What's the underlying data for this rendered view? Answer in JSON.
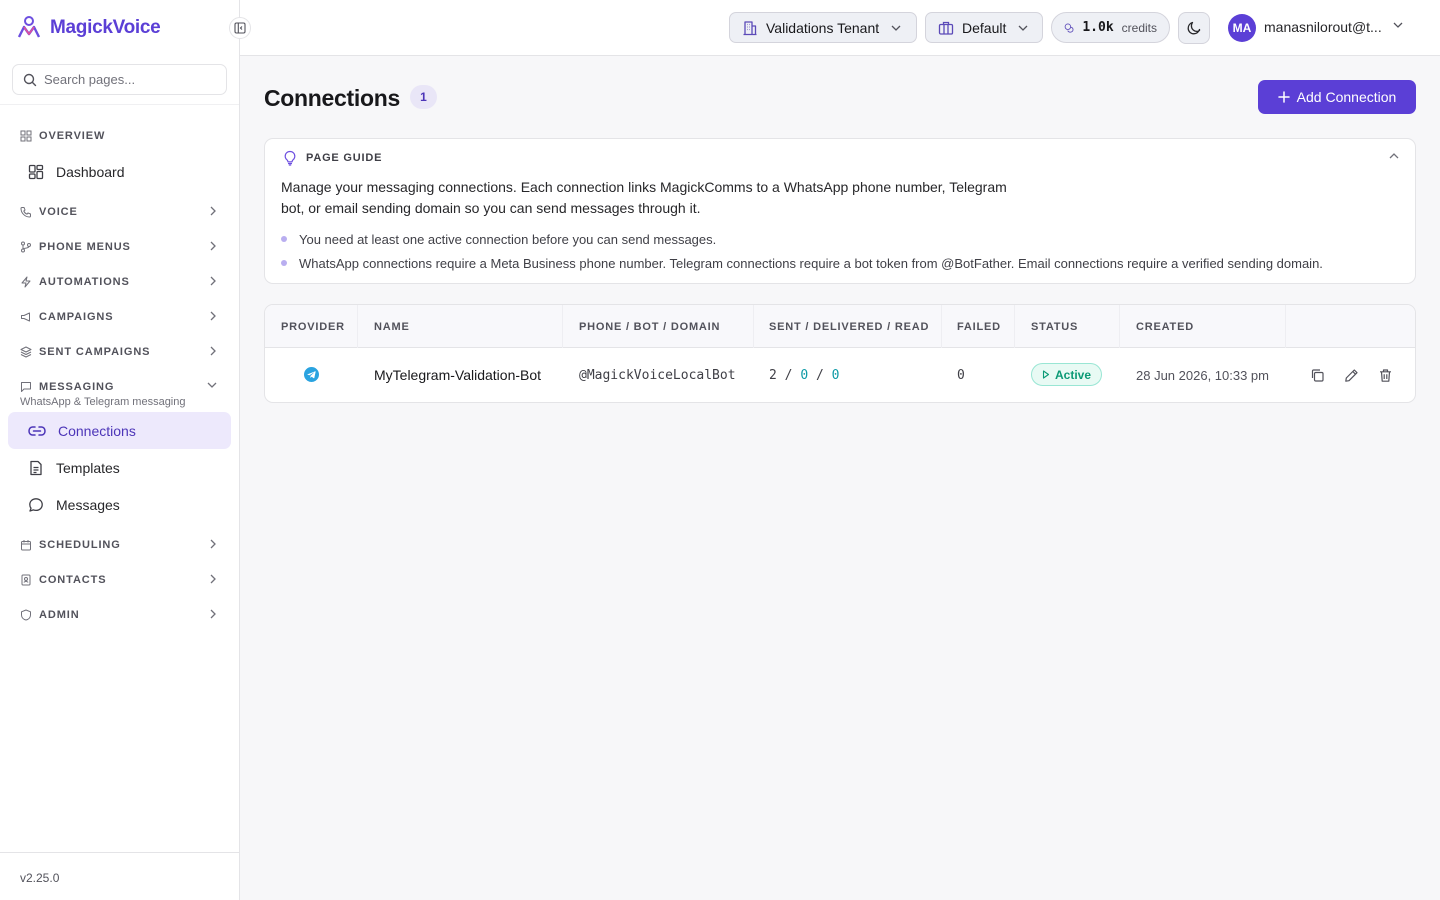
{
  "app": {
    "brand_name": "MagickVoice",
    "version": "v2.25.0"
  },
  "sidebar": {
    "search_placeholder": "Search pages...",
    "sections": {
      "overview": {
        "label": "OVERVIEW",
        "items": [
          {
            "label": "Dashboard"
          }
        ]
      },
      "voice": {
        "label": "VOICE"
      },
      "phone_menus": {
        "label": "PHONE MENUS"
      },
      "automations": {
        "label": "AUTOMATIONS"
      },
      "campaigns": {
        "label": "CAMPAIGNS"
      },
      "sent_campaigns": {
        "label": "SENT CAMPAIGNS"
      },
      "messaging": {
        "label": "MESSAGING",
        "subtitle": "WhatsApp & Telegram messaging",
        "items": [
          {
            "label": "Connections",
            "active": true
          },
          {
            "label": "Templates"
          },
          {
            "label": "Messages"
          }
        ]
      },
      "scheduling": {
        "label": "SCHEDULING"
      },
      "contacts": {
        "label": "CONTACTS"
      },
      "admin": {
        "label": "ADMIN"
      }
    }
  },
  "topbar": {
    "tenant": "Validations Tenant",
    "workspace": "Default",
    "credits_value": "1.0k",
    "credits_unit": "credits",
    "avatar_initials": "MA",
    "user_email": "manasnilorout@t..."
  },
  "page": {
    "title": "Connections",
    "count": "1",
    "add_button_label": "Add Connection"
  },
  "guide": {
    "title": "PAGE GUIDE",
    "description": "Manage your messaging connections. Each connection links MagickComms to a WhatsApp phone number, Telegram bot, or email sending domain so you can send messages through it.",
    "tips": [
      "You need at least one active connection before you can send messages.",
      "WhatsApp connections require a Meta Business phone number. Telegram connections require a bot token from @BotFather. Email connections require a verified sending domain."
    ]
  },
  "table": {
    "columns": [
      "PROVIDER",
      "NAME",
      "PHONE / BOT / DOMAIN",
      "SENT / DELIVERED / READ",
      "FAILED",
      "STATUS",
      "CREATED"
    ],
    "rows": [
      {
        "provider_icon": "telegram-icon",
        "name": "MyTelegram-Validation-Bot",
        "handle": "@MagickVoiceLocalBot",
        "sent": "2",
        "delivered": "0",
        "read": "0",
        "stat_sep": "/",
        "failed": "0",
        "status": "Active",
        "created": "28 Jun 2026, 10:33 pm"
      }
    ]
  },
  "colors": {
    "accent": "#5b3fd6",
    "active_nav_bg": "#ede9fc",
    "status_active": "#0c9a76",
    "telegram": "#2aa3e0"
  }
}
